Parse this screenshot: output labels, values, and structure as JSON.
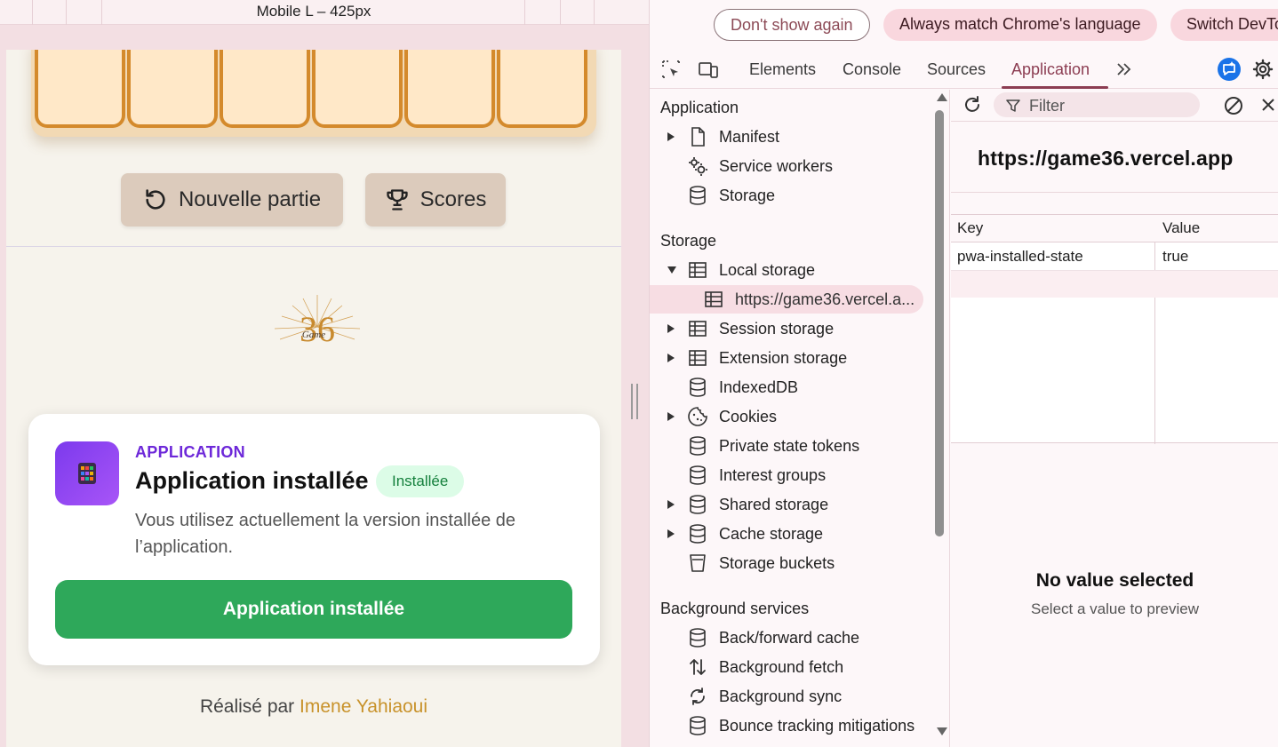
{
  "device_toolbar": {
    "label": "Mobile L – 425px"
  },
  "game": {
    "board_cells": 6,
    "new_game_label": "Nouvelle partie",
    "scores_label": "Scores",
    "logo_text": "36",
    "logo_script": "Game"
  },
  "install_card": {
    "eyebrow": "APPLICATION",
    "title": "Application installée",
    "badge": "Installée",
    "description": "Vous utilisez actuellement la version installée de l’application.",
    "button_label": "Application installée"
  },
  "credit": {
    "prefix": "Réalisé par",
    "author": "Imene Yahiaoui"
  },
  "colors": {
    "accent_purple": "#6d28d9",
    "install_green": "#2ea85a",
    "devtools_accent": "#8c3d52",
    "author_gold": "#c8922a"
  },
  "devtools": {
    "infobar": {
      "dont_show": "Don't show again",
      "always_match": "Always match Chrome's language",
      "switch": "Switch DevTo"
    },
    "tabs": {
      "elements": "Elements",
      "console": "Console",
      "sources": "Sources",
      "application": "Application",
      "active": "Application"
    },
    "sidebar": {
      "application_header": "Application",
      "application_items": [
        "Manifest",
        "Service workers",
        "Storage"
      ],
      "storage_header": "Storage",
      "local_storage": "Local storage",
      "local_storage_origin": "https://game36.vercel.a...",
      "storage_items": [
        "Session storage",
        "Extension storage",
        "IndexedDB",
        "Cookies",
        "Private state tokens",
        "Interest groups",
        "Shared storage",
        "Cache storage",
        "Storage buckets"
      ],
      "background_header": "Background services",
      "background_items": [
        "Back/forward cache",
        "Background fetch",
        "Background sync",
        "Bounce tracking mitigations"
      ]
    },
    "main": {
      "filter_placeholder": "Filter",
      "origin": "https://game36.vercel.app",
      "columns": {
        "key": "Key",
        "value": "Value"
      },
      "rows": [
        {
          "key": "pwa-installed-state",
          "value": "true"
        }
      ],
      "preview_title": "No value selected",
      "preview_subtitle": "Select a value to preview"
    }
  }
}
